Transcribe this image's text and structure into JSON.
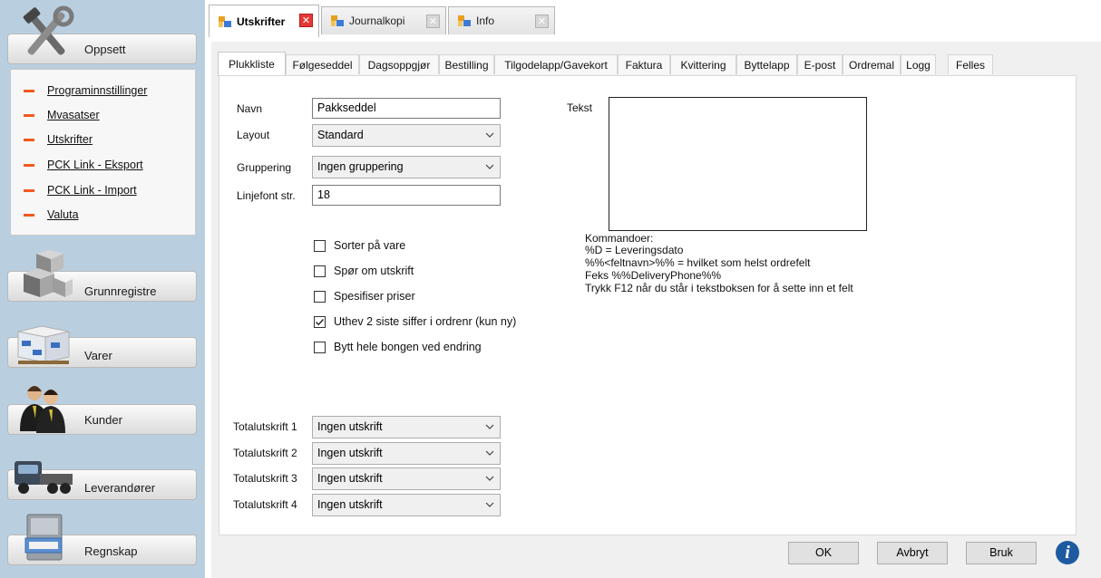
{
  "sidebar": {
    "sections": [
      {
        "label": "Oppsett",
        "icon": "tools-icon"
      },
      {
        "label": "Grunnregistre",
        "icon": "cubes-icon"
      },
      {
        "label": "Varer",
        "icon": "boxes-icon"
      },
      {
        "label": "Kunder",
        "icon": "people-icon"
      },
      {
        "label": "Leverandører",
        "icon": "truck-icon"
      },
      {
        "label": "Regnskap",
        "icon": "cabinet-icon"
      }
    ],
    "oppsett_links": [
      "Programinnstillinger",
      "Mvasatser",
      "Utskrifter",
      "PCK Link - Eksport",
      "PCK Link - Import",
      "Valuta"
    ]
  },
  "doc_tabs": [
    {
      "label": "Utskrifter",
      "active": true
    },
    {
      "label": "Journalkopi",
      "active": false
    },
    {
      "label": "Info",
      "active": false
    }
  ],
  "sub_tabs": [
    "Plukkliste",
    "Følgeseddel",
    "Dagsoppgjør",
    "Bestilling",
    "Tilgodelapp/Gavekort",
    "Faktura",
    "Kvittering",
    "Byttelapp",
    "E-post",
    "Ordremal",
    "Logg",
    "Felles"
  ],
  "active_sub_tab": "Plukkliste",
  "form": {
    "navn_label": "Navn",
    "navn_value": "Pakkseddel",
    "layout_label": "Layout",
    "layout_value": "Standard",
    "gruppering_label": "Gruppering",
    "gruppering_value": "Ingen gruppering",
    "linjefont_label": "Linjefont str.",
    "linjefont_value": "18",
    "checkboxes": [
      {
        "label": "Sorter på vare",
        "checked": false
      },
      {
        "label": "Spør om utskrift",
        "checked": false
      },
      {
        "label": "Spesifiser priser",
        "checked": false
      },
      {
        "label": "Uthev 2 siste siffer i ordrenr (kun ny)",
        "checked": true
      },
      {
        "label": "Bytt hele bongen ved endring",
        "checked": false
      }
    ],
    "totals": [
      {
        "label": "Totalutskrift 1",
        "value": "Ingen utskrift"
      },
      {
        "label": "Totalutskrift 2",
        "value": "Ingen utskrift"
      },
      {
        "label": "Totalutskrift 3",
        "value": "Ingen utskrift"
      },
      {
        "label": "Totalutskrift 4",
        "value": "Ingen utskrift"
      }
    ],
    "tekst_label": "Tekst",
    "tekst_value": "",
    "commands": [
      "Kommandoer:",
      "%D = Leveringsdato",
      "%%<feltnavn>%% = hvilket som helst ordrefelt",
      "Feks %%DeliveryPhone%%",
      "Trykk F12 når du står i tekstboksen for å sette inn et felt"
    ]
  },
  "buttons": {
    "ok": "OK",
    "cancel": "Avbryt",
    "apply": "Bruk"
  },
  "colors": {
    "sidebar_bg": "#b9cfe0",
    "link_dash": "#f4581f",
    "close_active": "#e53935",
    "info": "#1e5aa0"
  }
}
